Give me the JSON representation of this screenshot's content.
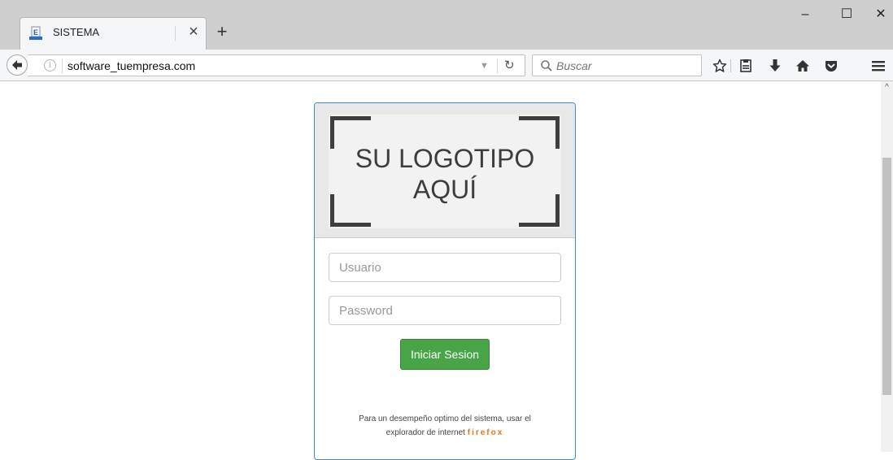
{
  "browser": {
    "tab": {
      "title": "SISTEMA",
      "close_glyph": "×"
    },
    "new_tab_glyph": "+",
    "window": {
      "minimize": "–",
      "maximize": "☐",
      "close": "✕"
    },
    "url": "software_tuempresa.com",
    "search_placeholder": "Buscar",
    "icons": [
      "back-icon",
      "info-icon",
      "reload-icon",
      "search-icon",
      "bookmark-star-icon",
      "reading-list-icon",
      "download-icon",
      "home-icon",
      "pocket-icon",
      "menu-icon"
    ]
  },
  "login": {
    "logo_text_line1": "SU LOGOTIPO",
    "logo_text_line2": "AQUÍ",
    "username_placeholder": "Usuario",
    "password_placeholder": "Password",
    "submit_label": "Iniciar Sesion",
    "note_line1": "Para un desempeño optimo del sistema, usar el",
    "note_line2_prefix": "explorador de internet",
    "note_browser": "firefox"
  },
  "colors": {
    "panel_border": "#428bca",
    "button": "#47a447",
    "firefox_accent": "#e8761a"
  }
}
